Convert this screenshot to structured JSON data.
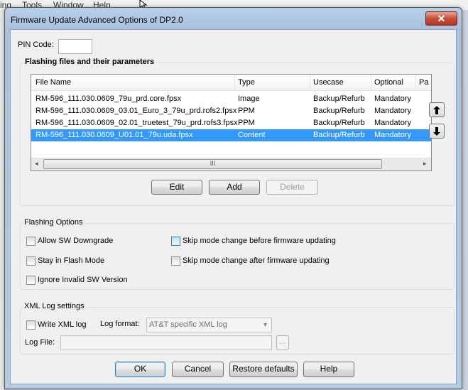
{
  "background_menu": [
    "ing",
    "Tools",
    "Window",
    "Help"
  ],
  "dialog": {
    "title": "Firmware Update Advanced Options of DP2.0",
    "close_label": "✕",
    "pin_label": "PIN Code:",
    "pin_value": ""
  },
  "files_group": {
    "title": "Flashing files and their parameters",
    "columns": [
      "File Name",
      "Type",
      "Usecase",
      "Optional",
      "Pa"
    ],
    "rows": [
      {
        "name": "RM-596_111.030.0609_79u_prd.core.fpsx",
        "type": "Image",
        "usecase": "Backup/Refurb",
        "optional": "Mandatory"
      },
      {
        "name": "RM-596_111.030.0609_03.01_Euro_3_79u_prd.rofs2.fpsx",
        "type": "PPM",
        "usecase": "Backup/Refurb",
        "optional": "Mandatory"
      },
      {
        "name": "RM-596_111.030.0609_02.01_truetest_79u_prd.rofs3.fpsx",
        "type": "PPM",
        "usecase": "Backup/Refurb",
        "optional": "Mandatory"
      },
      {
        "name": "RM-596_111.030.0609_U01.01_79u.uda.fpsx",
        "type": "Content",
        "usecase": "Backup/Refurb",
        "optional": "Mandatory"
      }
    ],
    "selected_row": 3,
    "scroll_left": "◂",
    "scroll_grip": "III",
    "scroll_right": "▸",
    "move_up": "🡅",
    "move_down": "🡇",
    "buttons": {
      "edit": "Edit",
      "add": "Add",
      "delete": "Delete"
    }
  },
  "flashing_options": {
    "title": "Flashing Options",
    "allow_downgrade": "Allow SW Downgrade",
    "stay_flash": "Stay in Flash Mode",
    "ignore_invalid": "Ignore Invalid SW Version",
    "skip_before": "Skip mode change before firmware updating",
    "skip_after": "Skip mode change after firmware updating"
  },
  "xml_log": {
    "title": "XML Log settings",
    "write_xml": "Write XML log",
    "format_label": "Log format:",
    "format_value": "AT&T specific XML log",
    "file_label": "Log File:",
    "file_value": "",
    "browse": "..."
  },
  "footer": {
    "ok": "OK",
    "cancel": "Cancel",
    "restore": "Restore defaults",
    "help": "Help"
  }
}
